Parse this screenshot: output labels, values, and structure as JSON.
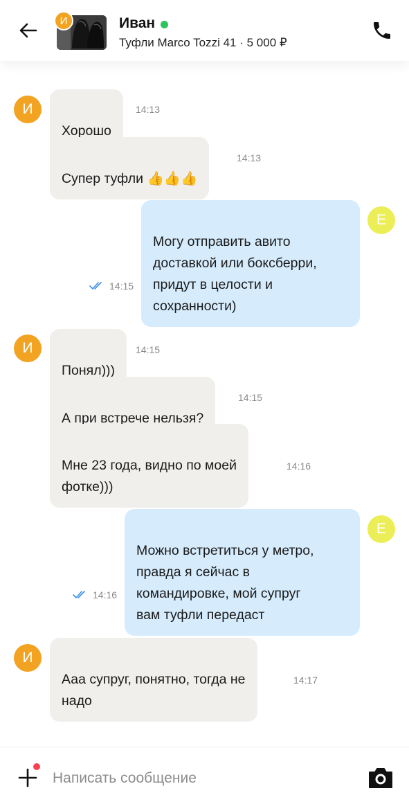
{
  "header": {
    "avatar_letter": "И",
    "name": "Иван",
    "listing": "Туфли Marco Tozzi 41 · 5 000 ₽"
  },
  "messages": [
    {
      "side": "in",
      "text": "Хорошо",
      "time": "14:13"
    },
    {
      "side": "in",
      "text": "Супер туфли 👍👍👍",
      "time": "14:13"
    },
    {
      "side": "out",
      "text": "Могу отправить авито\nдоставкой или боксберри,\nпридут в целости и\nсохранности)",
      "time": "14:15",
      "avatar_letter": "Е"
    },
    {
      "side": "in",
      "text": "Понял)))",
      "time": "14:15"
    },
    {
      "side": "in",
      "text": "А при встрече нельзя?",
      "time": "14:15"
    },
    {
      "side": "in",
      "text": "Мне 23 года, видно по моей\nфотке)))",
      "time": "14:16"
    },
    {
      "side": "out",
      "text": "Можно встретиться у метро,\nправда я сейчас в\nкомандировке, мой супруг\nвам туфли передаст",
      "time": "14:16",
      "avatar_letter": "Е"
    },
    {
      "side": "in",
      "text": "Ааа супруг, понятно, тогда не\nнадо",
      "time": "14:17"
    }
  ],
  "incoming_avatar_letter": "И",
  "composer": {
    "placeholder": "Написать сообщение"
  },
  "colors": {
    "incoming_bubble": "#f1efec",
    "outgoing_bubble": "#d6ecfd",
    "incoming_avatar": "#f2a321",
    "outgoing_avatar": "#ecee57",
    "online": "#2ec45c",
    "read_check": "#3a8ee6",
    "notify_dot": "#ff4053"
  }
}
